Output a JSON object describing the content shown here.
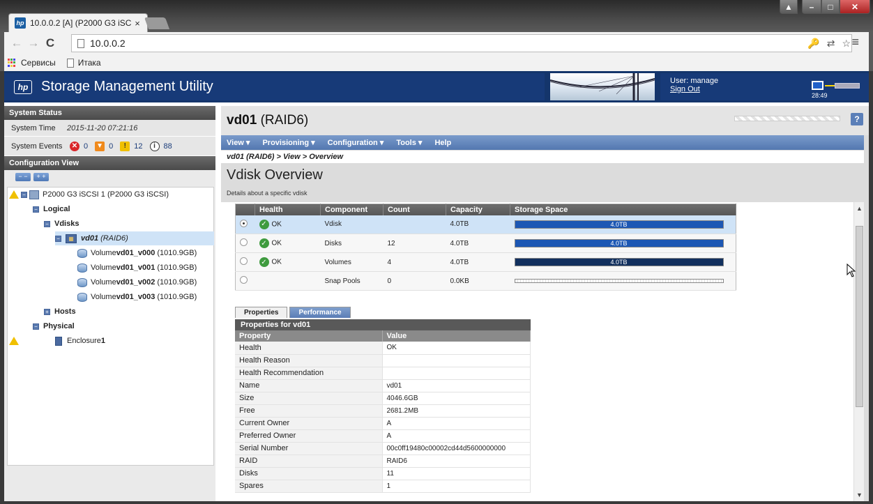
{
  "browser": {
    "tab_title": "10.0.0.2 [A] (P2000 G3 iSC",
    "tab_close": "×",
    "url": "10.0.0.2",
    "bookmarks": [
      {
        "label": "Сервисы"
      },
      {
        "label": "Итака"
      }
    ]
  },
  "banner": {
    "logo": "hp",
    "title": "Storage Management Utility",
    "user_label": "User: manage",
    "signout_label": "Sign Out",
    "clock": "28:49"
  },
  "left_panel": {
    "system_status_head": "System Status",
    "system_time_label": "System Time",
    "system_time_value": "2015-11-20 07:21:16",
    "system_events_label": "System Events",
    "events": {
      "critical": "0",
      "error": "0",
      "warning": "12",
      "info": "88"
    },
    "config_view_head": "Configuration View",
    "collapse_all": "− −",
    "expand_all": "+ +",
    "tree": {
      "system": "P2000 G3 iSCSI 1 (P2000 G3 iSCSI)",
      "logical": "Logical",
      "vdisks": "Vdisks",
      "vdisk_name": "vd01",
      "vdisk_raid": "(RAID6)",
      "volumes": [
        {
          "prefix": "Volume ",
          "name": "vd01_v000",
          "size": "(1010.9GB)"
        },
        {
          "prefix": "Volume ",
          "name": "vd01_v001",
          "size": "(1010.9GB)"
        },
        {
          "prefix": "Volume ",
          "name": "vd01_v002",
          "size": "(1010.9GB)"
        },
        {
          "prefix": "Volume ",
          "name": "vd01_v003",
          "size": "(1010.9GB)"
        }
      ],
      "hosts": "Hosts",
      "physical": "Physical",
      "enclosure_prefix": "Enclosure ",
      "enclosure_num": "1"
    }
  },
  "right_panel": {
    "title_name": "vd01",
    "title_raid": " (RAID6)",
    "help": "?",
    "menu": [
      "View ▾",
      "Provisioning ▾",
      "Configuration ▾",
      "Tools ▾",
      "Help"
    ],
    "breadcrumb": "vd01 (RAID6) > View > Overview",
    "section_title": "Vdisk Overview",
    "section_subtitle": "Details about a specific vdisk",
    "components": {
      "headers": [
        "",
        "Health",
        "Component",
        "Count",
        "Capacity",
        "Storage Space"
      ],
      "rows": [
        {
          "health": "OK",
          "component": "Vdisk",
          "count": "",
          "capacity": "4.0TB",
          "space_label": "4.0TB",
          "fill": 1.0,
          "selected": true
        },
        {
          "health": "OK",
          "component": "Disks",
          "count": "12",
          "capacity": "4.0TB",
          "space_label": "4.0TB",
          "fill": 1.0,
          "selected": false
        },
        {
          "health": "OK",
          "component": "Volumes",
          "count": "4",
          "capacity": "4.0TB",
          "space_label": "4.0TB",
          "fill": 1.0,
          "selected": false
        },
        {
          "health": "",
          "component": "Snap Pools",
          "count": "0",
          "capacity": "0.0KB",
          "space_label": "",
          "fill": 0,
          "selected": false
        }
      ]
    },
    "tabs": [
      "Properties",
      "Performance"
    ],
    "properties_title": "Properties for vd01",
    "properties": {
      "headers": [
        "Property",
        "Value"
      ],
      "rows": [
        {
          "name": "Health",
          "value": "OK"
        },
        {
          "name": "Health Reason",
          "value": ""
        },
        {
          "name": "Health Recommendation",
          "value": ""
        },
        {
          "name": "Name",
          "value": "vd01"
        },
        {
          "name": "Size",
          "value": "4046.6GB"
        },
        {
          "name": "Free",
          "value": "2681.2MB"
        },
        {
          "name": "Current Owner",
          "value": "A"
        },
        {
          "name": "Preferred Owner",
          "value": "A"
        },
        {
          "name": "Serial Number",
          "value": "00c0ff19480c00002cd44d5600000000"
        },
        {
          "name": "RAID",
          "value": "RAID6"
        },
        {
          "name": "Disks",
          "value": "11"
        },
        {
          "name": "Spares",
          "value": "1"
        }
      ]
    }
  }
}
